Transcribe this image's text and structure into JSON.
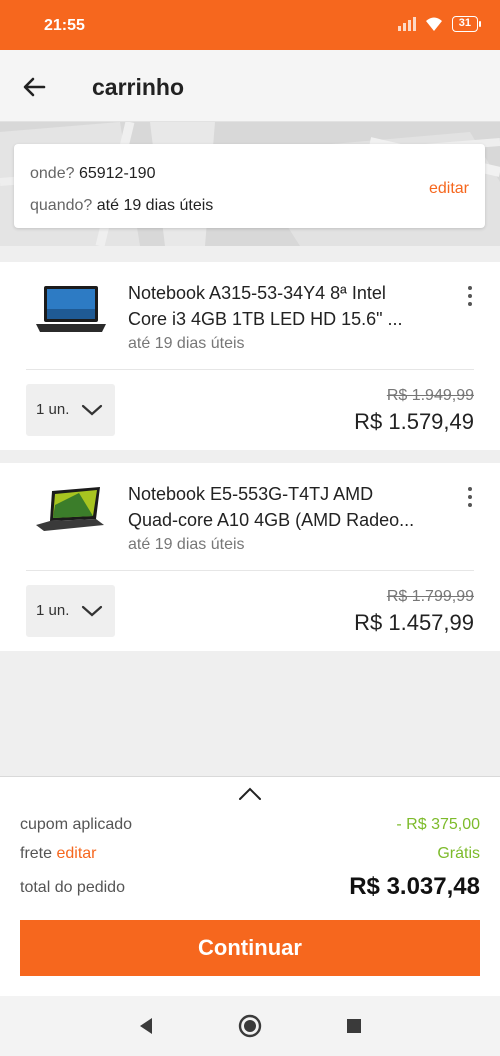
{
  "status_bar": {
    "time": "21:55",
    "battery": "31"
  },
  "header": {
    "title": "carrinho",
    "back_icon": "arrow-left-icon"
  },
  "delivery": {
    "where_label": "onde?",
    "where_value": "65912-190",
    "when_label": "quando?",
    "when_value": "até 19 dias úteis",
    "edit_label": "editar"
  },
  "items": [
    {
      "name_line1": "Notebook A315-53-34Y4 8ª Intel",
      "name_line2": "Core i3 4GB 1TB LED HD 15.6\" ...",
      "delivery": "até 19 dias úteis",
      "quantity": "1 un.",
      "old_price": "R$ 1.949,99",
      "price": "R$ 1.579,49"
    },
    {
      "name_line1": "Notebook E5-553G-T4TJ AMD",
      "name_line2": "Quad-core A10 4GB (AMD Radeo...",
      "delivery": "até 19 dias úteis",
      "quantity": "1 un.",
      "old_price": "R$ 1.799,99",
      "price": "R$ 1.457,99"
    }
  ],
  "summary": {
    "coupon_label": "cupom aplicado",
    "coupon_value": "- R$ 375,00",
    "shipping_label": "frete",
    "shipping_edit": "editar",
    "shipping_value": "Grátis",
    "total_label": "total do pedido",
    "total_value": "R$ 3.037,48",
    "continue_label": "Continuar"
  },
  "colors": {
    "accent": "#f6671e",
    "discount": "#7dbb2b"
  }
}
